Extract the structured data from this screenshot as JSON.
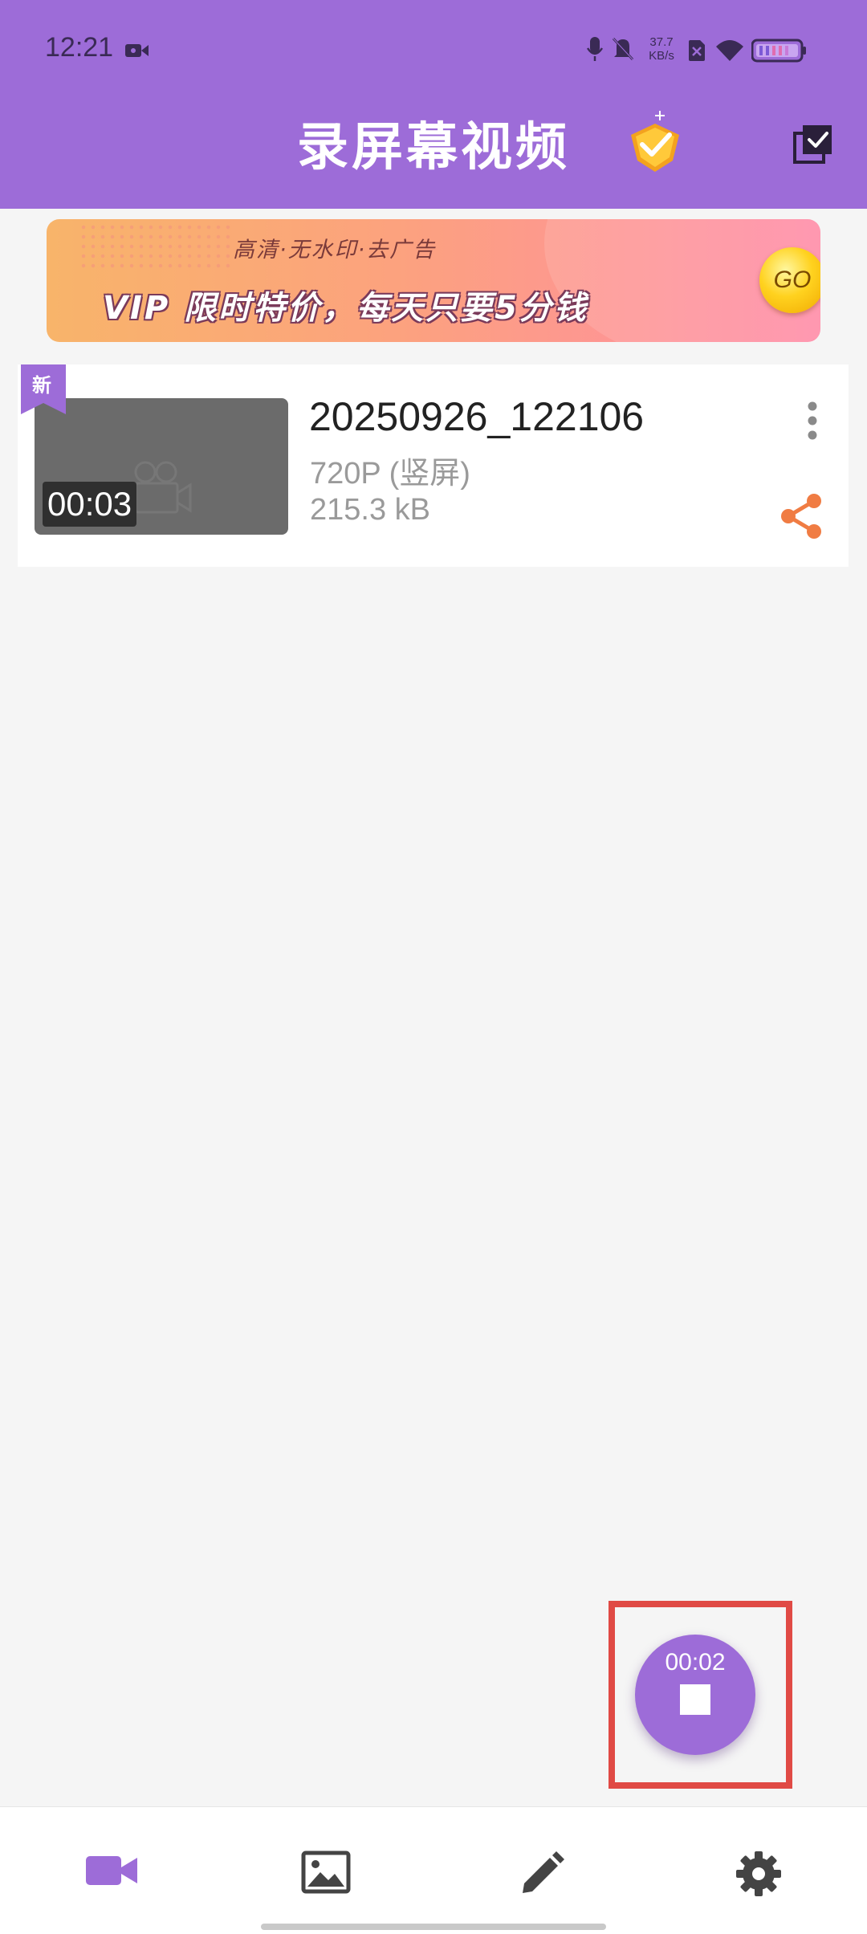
{
  "status_bar": {
    "time": "12:21",
    "network_speed_value": "37.7",
    "network_speed_unit": "KB/s",
    "icons": [
      "screen-record-icon",
      "mic-icon",
      "mute-bell-icon",
      "sim-off-icon",
      "wifi-icon",
      "battery-icon"
    ]
  },
  "header": {
    "title": "录屏幕视频",
    "background_color": "#9d6cd8",
    "icons": [
      "vip-badge-icon",
      "multi-select-icon"
    ]
  },
  "banner": {
    "subtitle": "高清·无水印·去广告",
    "headline": "VIP 限时特价，每天只要5分钱",
    "go_label": "GO"
  },
  "videos": [
    {
      "new_flag": "新",
      "duration": "00:03",
      "name": "20250926_122106",
      "resolution": "720P (竖屏)",
      "size": "215.3 kB"
    }
  ],
  "fab": {
    "timer": "00:02",
    "action": "stop-recording"
  },
  "bottom_nav": {
    "items": [
      "video-camera-icon",
      "image-icon",
      "edit-icon",
      "settings-icon"
    ],
    "active_index": 0,
    "active_color": "#9d6cd8",
    "inactive_color": "#444444"
  },
  "accent_colors": {
    "primary": "#9d6cd8",
    "share": "#f07c43",
    "highlight_border": "#e04a45"
  }
}
